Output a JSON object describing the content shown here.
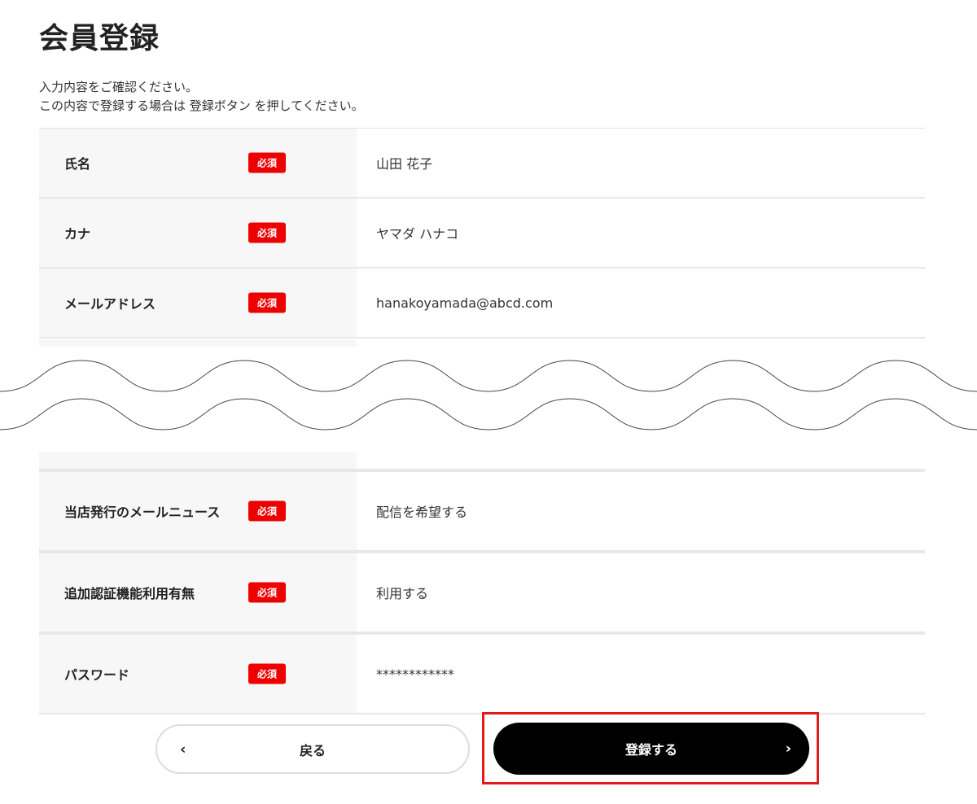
{
  "header": {
    "title": "会員登録",
    "intro_line1": "入力内容をご確認ください。",
    "intro_line2": "この内容で登録する場合は 登録ボタン を押してください。"
  },
  "required_badge": "必須",
  "fields_top": [
    {
      "label": "氏名",
      "value": "山田 花子"
    },
    {
      "label": "カナ",
      "value": "ヤマダ ハナコ"
    },
    {
      "label": "メールアドレス",
      "value": "hanakoyamada@abcd.com"
    }
  ],
  "fields_bottom": [
    {
      "label": "当店発行のメールニュース",
      "value": "配信を希望する"
    },
    {
      "label": "追加認証機能利用有無",
      "value": "利用する"
    },
    {
      "label": "パスワード",
      "value": "************"
    }
  ],
  "actions": {
    "back_label": "戻る",
    "back_icon": "chevron-left-icon",
    "submit_label": "登録する",
    "submit_icon": "chevron-right-icon",
    "highlight_color": "#e21a1a"
  },
  "colors": {
    "badge": "#ee0000",
    "label_bg": "#f7f7f7",
    "submit_bg": "#000000"
  }
}
